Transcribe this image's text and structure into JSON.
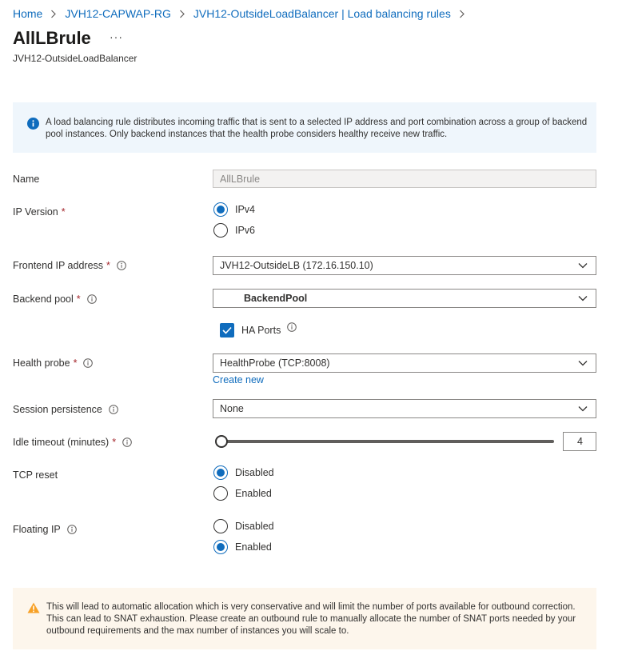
{
  "breadcrumb": [
    {
      "label": "Home"
    },
    {
      "label": "JVH12-CAPWAP-RG"
    },
    {
      "label": "JVH12-OutsideLoadBalancer | Load balancing rules"
    }
  ],
  "page": {
    "title": "AllLBrule",
    "more_label": "···",
    "subtitle": "JVH12-OutsideLoadBalancer"
  },
  "info": {
    "icon": "info-icon",
    "text": "A load balancing rule distributes incoming traffic that is sent to a selected IP address and port combination across a group of backend pool instances. Only backend instances that the health probe considers healthy receive new traffic."
  },
  "form": {
    "name": {
      "label": "Name",
      "value": "AllLBrule"
    },
    "ip_version": {
      "label": "IP Version",
      "required": "*",
      "options": [
        "IPv4",
        "IPv6"
      ],
      "selected": "IPv4"
    },
    "frontend_ip": {
      "label": "Frontend IP address",
      "required": "*",
      "value": "JVH12-OutsideLB (172.16.150.10)"
    },
    "backend_pool": {
      "label": "Backend pool",
      "required": "*",
      "value": "BackendPool"
    },
    "ha_ports": {
      "label": "HA Ports",
      "checked": true
    },
    "health_probe": {
      "label": "Health probe",
      "required": "*",
      "value": "HealthProbe (TCP:8008)",
      "create_new": "Create new"
    },
    "session_persistence": {
      "label": "Session persistence",
      "value": "None"
    },
    "idle_timeout": {
      "label": "Idle timeout (minutes)",
      "required": "*",
      "value": "4",
      "slider_min": 4,
      "slider_max": 30
    },
    "tcp_reset": {
      "label": "TCP reset",
      "options": [
        "Disabled",
        "Enabled"
      ],
      "selected": "Disabled"
    },
    "floating_ip": {
      "label": "Floating IP",
      "options": [
        "Disabled",
        "Enabled"
      ],
      "selected": "Enabled"
    }
  },
  "warning": {
    "icon": "warning-icon",
    "text": "This will lead to automatic allocation which is very conservative and will limit the number of ports available for outbound correction. This can lead to SNAT exhaustion. Please create an outbound rule to manually allocate the number of SNAT ports needed by your outbound requirements and the max number of instances you will scale to."
  },
  "colors": {
    "accent": "#0f6cbd",
    "required": "#a4262c",
    "info_bg": "#eff6fc",
    "warning_bg": "#fdf6ec",
    "warning_icon": "#f7a127"
  }
}
